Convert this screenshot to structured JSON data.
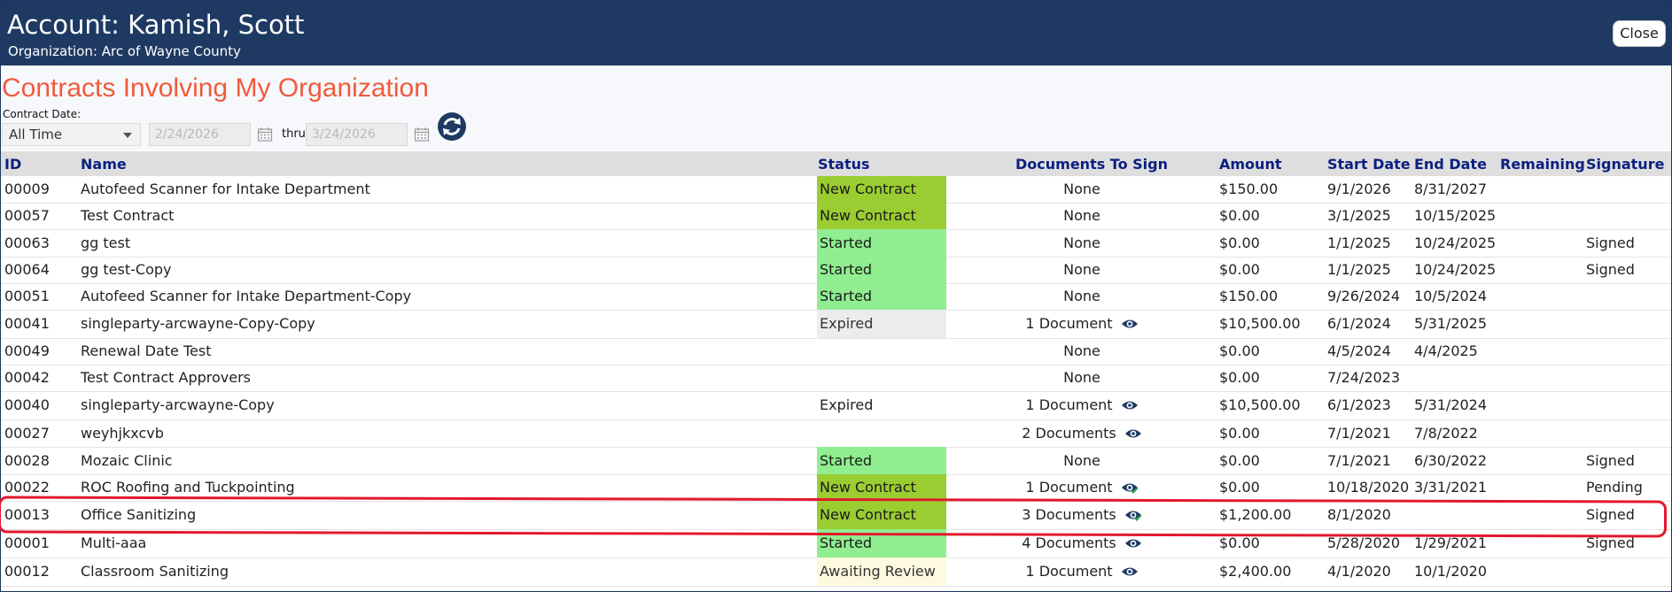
{
  "account": {
    "title": "Account: Kamish, Scott",
    "organization_line": "Organization: Arc of Wayne County",
    "close_label": "Close"
  },
  "section_title": "Contracts Involving My Organization",
  "filter": {
    "date_label": "Contract Date:",
    "range_value": "All Time",
    "from_placeholder": "2/24/2026",
    "thru_label": "thru",
    "to_placeholder": "3/24/2026"
  },
  "colors": {
    "header_bg": "#1e3a63",
    "title_orange": "#f05a3c",
    "column_header": "#0b1f80",
    "new_contract": "#9acd32",
    "started": "#90ee90",
    "expired": "#ececec",
    "awaiting_review": "#fefae0",
    "highlight": "#e2192c"
  },
  "table": {
    "columns": [
      "ID",
      "Name",
      "Status",
      "Documents To Sign",
      "Amount",
      "Start Date",
      "End Date",
      "Remaining",
      "Signature"
    ],
    "rows": [
      {
        "id": "00009",
        "name": "Autofeed Scanner for Intake Department",
        "status": "New Contract",
        "status_style": "new",
        "docs": "None",
        "eye": "",
        "amount": "$150.00",
        "start": "9/1/2026",
        "end": "8/31/2027",
        "remaining": "",
        "signature": ""
      },
      {
        "id": "00057",
        "name": "Test Contract",
        "status": "New Contract",
        "status_style": "new",
        "docs": "None",
        "eye": "",
        "amount": "$0.00",
        "start": "3/1/2025",
        "end": "10/15/2025",
        "remaining": "",
        "signature": ""
      },
      {
        "id": "00063",
        "name": "gg test",
        "status": "Started",
        "status_style": "started",
        "docs": "None",
        "eye": "",
        "amount": "$0.00",
        "start": "1/1/2025",
        "end": "10/24/2025",
        "remaining": "",
        "signature": "Signed"
      },
      {
        "id": "00064",
        "name": "gg test-Copy",
        "status": "Started",
        "status_style": "started",
        "docs": "None",
        "eye": "",
        "amount": "$0.00",
        "start": "1/1/2025",
        "end": "10/24/2025",
        "remaining": "",
        "signature": "Signed"
      },
      {
        "id": "00051",
        "name": "Autofeed Scanner for Intake Department-Copy",
        "status": "Started",
        "status_style": "started",
        "docs": "None",
        "eye": "",
        "amount": "$150.00",
        "start": "9/26/2024",
        "end": "10/5/2024",
        "remaining": "",
        "signature": ""
      },
      {
        "id": "00041",
        "name": "singleparty-arcwayne-Copy-Copy",
        "status": "Expired",
        "status_style": "expired",
        "docs": "1 Document",
        "eye": "eye-icon",
        "amount": "$10,500.00",
        "start": "6/1/2024",
        "end": "5/31/2025",
        "remaining": "",
        "signature": ""
      },
      {
        "id": "00049",
        "name": "Renewal Date Test",
        "status": "",
        "status_style": "none",
        "docs": "None",
        "eye": "",
        "amount": "$0.00",
        "start": "4/5/2024",
        "end": "4/4/2025",
        "remaining": "",
        "signature": ""
      },
      {
        "id": "00042",
        "name": "Test Contract Approvers",
        "status": "",
        "status_style": "none",
        "docs": "None",
        "eye": "",
        "amount": "$0.00",
        "start": "7/24/2023",
        "end": "",
        "remaining": "",
        "signature": ""
      },
      {
        "id": "00040",
        "name": "singleparty-arcwayne-Copy",
        "status": "Expired",
        "status_style": "plain",
        "docs": "1 Document",
        "eye": "eye-icon",
        "amount": "$10,500.00",
        "start": "6/1/2023",
        "end": "5/31/2024",
        "remaining": "",
        "signature": ""
      },
      {
        "id": "00027",
        "name": "weyhjkxcvb",
        "status": "",
        "status_style": "none",
        "docs": "2 Documents",
        "eye": "eye-icon",
        "amount": "$0.00",
        "start": "7/1/2021",
        "end": "7/8/2022",
        "remaining": "",
        "signature": ""
      },
      {
        "id": "00028",
        "name": "Mozaic Clinic",
        "status": "Started",
        "status_style": "started",
        "docs": "None",
        "eye": "",
        "amount": "$0.00",
        "start": "7/1/2021",
        "end": "6/30/2022",
        "remaining": "",
        "signature": "Signed"
      },
      {
        "id": "00022",
        "name": "ROC Roofing and Tuckpointing",
        "status": "New Contract",
        "status_style": "new",
        "docs": "1 Document",
        "eye": "eye-check-icon",
        "amount": "$0.00",
        "start": "10/18/2020",
        "end": "3/31/2021",
        "remaining": "",
        "signature": "Pending"
      },
      {
        "id": "00013",
        "name": "Office Sanitizing",
        "status": "New Contract",
        "status_style": "new",
        "docs": "3 Documents",
        "eye": "eye-check-icon",
        "amount": "$1,200.00",
        "start": "8/1/2020",
        "end": "",
        "remaining": "",
        "signature": "Signed"
      },
      {
        "id": "00001",
        "name": "Multi-aaa",
        "status": "Started",
        "status_style": "started",
        "docs": "4 Documents",
        "eye": "eye-icon",
        "amount": "$0.00",
        "start": "5/28/2020",
        "end": "1/29/2021",
        "remaining": "",
        "signature": "Signed"
      },
      {
        "id": "00012",
        "name": "Classroom Sanitizing",
        "status": "Awaiting Review",
        "status_style": "review",
        "docs": "1 Document",
        "eye": "eye-icon",
        "amount": "$2,400.00",
        "start": "4/1/2020",
        "end": "10/1/2020",
        "remaining": "",
        "signature": ""
      }
    ]
  }
}
